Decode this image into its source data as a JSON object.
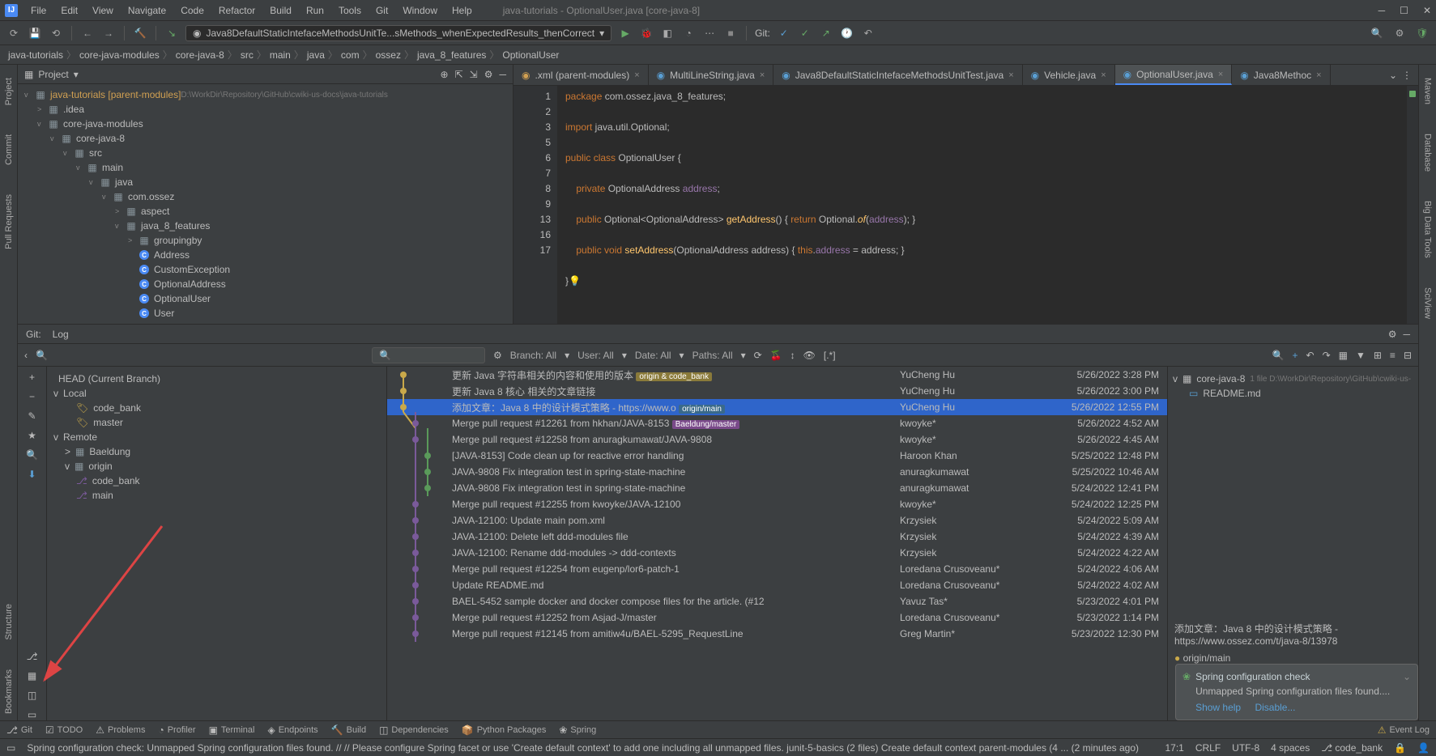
{
  "window": {
    "title": "java-tutorials - OptionalUser.java [core-java-8]"
  },
  "menu": [
    "File",
    "Edit",
    "View",
    "Navigate",
    "Code",
    "Refactor",
    "Build",
    "Run",
    "Tools",
    "Git",
    "Window",
    "Help"
  ],
  "toolbar": {
    "run_config": "Java8DefaultStaticIntefaceMethodsUnitTe...sMethods_whenExpectedResults_thenCorrect",
    "git_label": "Git:"
  },
  "breadcrumbs": [
    "java-tutorials",
    "core-java-modules",
    "core-java-8",
    "src",
    "main",
    "java",
    "com",
    "ossez",
    "java_8_features",
    "OptionalUser"
  ],
  "project": {
    "title": "Project",
    "root": "java-tutorials [parent-modules]",
    "root_path": "D:\\WorkDir\\Repository\\GitHub\\cwiki-us-docs\\java-tutorials",
    "nodes": [
      {
        "indent": 1,
        "arrow": ">",
        "icon": "folder",
        "label": ".idea"
      },
      {
        "indent": 1,
        "arrow": "v",
        "icon": "module",
        "label": "core-java-modules"
      },
      {
        "indent": 2,
        "arrow": "v",
        "icon": "module",
        "label": "core-java-8"
      },
      {
        "indent": 3,
        "arrow": "v",
        "icon": "folder",
        "label": "src"
      },
      {
        "indent": 4,
        "arrow": "v",
        "icon": "folder",
        "label": "main"
      },
      {
        "indent": 5,
        "arrow": "v",
        "icon": "folder",
        "label": "java"
      },
      {
        "indent": 6,
        "arrow": "v",
        "icon": "package",
        "label": "com.ossez"
      },
      {
        "indent": 7,
        "arrow": ">",
        "icon": "package",
        "label": "aspect"
      },
      {
        "indent": 7,
        "arrow": "v",
        "icon": "package",
        "label": "java_8_features"
      },
      {
        "indent": 8,
        "arrow": ">",
        "icon": "package",
        "label": "groupingby"
      },
      {
        "indent": 8,
        "arrow": "",
        "icon": "class",
        "label": "Address"
      },
      {
        "indent": 8,
        "arrow": "",
        "icon": "class",
        "label": "CustomException"
      },
      {
        "indent": 8,
        "arrow": "",
        "icon": "class",
        "label": "OptionalAddress"
      },
      {
        "indent": 8,
        "arrow": "",
        "icon": "class",
        "label": "OptionalUser"
      },
      {
        "indent": 8,
        "arrow": "",
        "icon": "class",
        "label": "User"
      }
    ]
  },
  "editor": {
    "tabs": [
      {
        "label": ".xml (parent-modules)",
        "icon": "xml"
      },
      {
        "label": "MultiLineString.java",
        "icon": "java"
      },
      {
        "label": "Java8DefaultStaticIntefaceMethodsUnitTest.java",
        "icon": "java"
      },
      {
        "label": "Vehicle.java",
        "icon": "java"
      },
      {
        "label": "OptionalUser.java",
        "icon": "java",
        "active": true
      },
      {
        "label": "Java8Methoc",
        "icon": "java"
      }
    ],
    "lines": [
      "1",
      "2",
      "3",
      "",
      "5",
      "6",
      "7",
      "8",
      "9",
      "",
      "13",
      "",
      "16",
      "17"
    ],
    "code": "package com.ossez.java_8_features;\n\nimport java.util.Optional;\n\npublic class OptionalUser {\n\n    private OptionalAddress address;\n\n    public Optional<OptionalAddress> getAddress() { return Optional.of(address); }\n\n    public void setAddress(OptionalAddress address) { this.address = address; }\n\n}\n"
  },
  "git": {
    "tabs": [
      "Git:",
      "Log"
    ],
    "filters": {
      "branch": "Branch: All",
      "user": "User: All",
      "date": "Date: All",
      "paths": "Paths: All"
    },
    "left_tree": {
      "head": "HEAD (Current Branch)",
      "local": "Local",
      "local_branches": [
        "code_bank",
        "master"
      ],
      "remote": "Remote",
      "remotes": [
        {
          "name": "Baeldung",
          "branches": []
        },
        {
          "name": "origin",
          "branches": [
            "code_bank",
            "main"
          ]
        }
      ]
    },
    "commits": [
      {
        "msg": "更新 Java 字符串相关的内容和使用的版本",
        "tags": [
          "origin & code_bank"
        ],
        "author": "YuCheng Hu",
        "date": "5/26/2022 3:28 PM",
        "dim": false
      },
      {
        "msg": "更新 Java 8 核心 相关的文章链接",
        "author": "YuCheng Hu",
        "date": "5/26/2022 3:00 PM",
        "dim": false
      },
      {
        "msg": "添加文章：Java 8 中的设计模式策略 - https://www.o",
        "tags": [
          "origin/main"
        ],
        "author": "YuCheng Hu",
        "date": "5/26/2022 12:55 PM",
        "sel": true
      },
      {
        "msg": "Merge pull request #12261 from hkhan/JAVA-8153",
        "tags": [
          "Baeldung/master"
        ],
        "author": "kwoyke*",
        "date": "5/26/2022 4:52 AM",
        "dim": true
      },
      {
        "msg": "Merge pull request #12258 from anuragkumawat/JAVA-9808",
        "author": "kwoyke*",
        "date": "5/26/2022 4:45 AM",
        "dim": true
      },
      {
        "msg": "[JAVA-8153] Code clean up for reactive error handling",
        "author": "Haroon Khan",
        "date": "5/25/2022 12:48 PM",
        "dim": false
      },
      {
        "msg": "JAVA-9808 Fix integration test in spring-state-machine",
        "author": "anuragkumawat",
        "date": "5/25/2022 10:46 AM",
        "dim": false
      },
      {
        "msg": "JAVA-9808 Fix integration test in spring-state-machine",
        "author": "anuragkumawat",
        "date": "5/24/2022 12:41 PM",
        "dim": false
      },
      {
        "msg": "Merge pull request #12255 from kwoyke/JAVA-12100",
        "author": "kwoyke*",
        "date": "5/24/2022 12:25 PM",
        "dim": true
      },
      {
        "msg": "JAVA-12100: Update main pom.xml",
        "author": "Krzysiek",
        "date": "5/24/2022 5:09 AM",
        "dim": false
      },
      {
        "msg": "JAVA-12100: Delete left ddd-modules file",
        "author": "Krzysiek",
        "date": "5/24/2022 4:39 AM",
        "dim": false
      },
      {
        "msg": "JAVA-12100: Rename ddd-modules -> ddd-contexts",
        "author": "Krzysiek",
        "date": "5/24/2022 4:22 AM",
        "dim": false
      },
      {
        "msg": "Merge pull request #12254 from eugenp/lor6-patch-1",
        "author": "Loredana Crusoveanu*",
        "date": "5/24/2022 4:06 AM",
        "dim": true
      },
      {
        "msg": "Update README.md",
        "author": "Loredana Crusoveanu*",
        "date": "5/24/2022 4:02 AM",
        "dim": false
      },
      {
        "msg": "BAEL-5452 sample docker and docker compose files for the article. (#12",
        "author": "Yavuz Tas*",
        "date": "5/23/2022 4:01 PM",
        "dim": false
      },
      {
        "msg": "Merge pull request #12252 from Asjad-J/master",
        "author": "Loredana Crusoveanu*",
        "date": "5/23/2022 1:14 PM",
        "dim": true
      },
      {
        "msg": "Merge pull request #12145 from amitiw4u/BAEL-5295_RequestLine",
        "author": "Greg Martin*",
        "date": "5/23/2022 12:30 PM",
        "dim": true
      }
    ],
    "right": {
      "folder": "core-java-8",
      "folder_meta": "1 file D:\\WorkDir\\Repository\\GitHub\\cwiki-us-",
      "file": "README.md",
      "commit_preview": "添加文章：Java 8 中的设计模式策略 - https://www.ossez.com/t/java-8/13978",
      "origin_main": "origin/main"
    }
  },
  "notif": {
    "title": "Spring configuration check",
    "body": "Unmapped Spring configuration files found....",
    "show": "Show help",
    "disable": "Disable..."
  },
  "bottom_tabs": [
    "Git",
    "TODO",
    "Problems",
    "Profiler",
    "Terminal",
    "Endpoints",
    "Build",
    "Dependencies",
    "Python Packages",
    "Spring"
  ],
  "event_log": "Event Log",
  "status": {
    "msg": "Spring configuration check: Unmapped Spring configuration files found. // // Please configure Spring facet or use 'Create default context' to add one including all unmapped files. junit-5-basics (2 files)   Create default context parent-modules (4 ... (2 minutes ago)",
    "pos": "17:1",
    "crlf": "CRLF",
    "enc": "UTF-8",
    "indent": "4 spaces",
    "branch": "code_bank"
  }
}
